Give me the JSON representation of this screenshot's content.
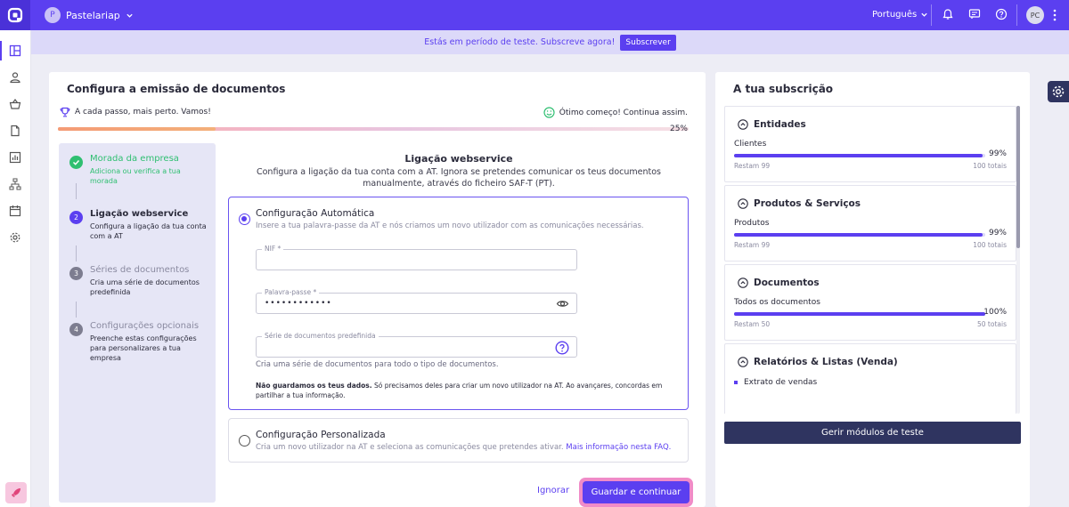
{
  "topbar": {
    "company_initial": "P",
    "company_name": "Pastelariap",
    "language": "Português",
    "user_initials": "PC"
  },
  "banner": {
    "text": "Estás em período de teste. Subscreve agora!",
    "button": "Subscrever"
  },
  "setup": {
    "title": "Configura a emissão de documentos",
    "progress_left": "A cada passo, mais perto. Vamos!",
    "progress_right": "Ótimo começo! Continua assim.",
    "progress_percent_label": "25%",
    "progress_value": 0.25,
    "steps": [
      {
        "number": "1",
        "title": "Morada da empresa",
        "desc": "Adiciona ou verifica a tua morada",
        "state": "done"
      },
      {
        "number": "2",
        "title": "Ligação webservice",
        "desc": "Configura a ligação da tua conta com a AT",
        "state": "active"
      },
      {
        "number": "3",
        "title": "Séries de documentos",
        "desc": "Cria uma série de documentos predefinida",
        "state": "pending"
      },
      {
        "number": "4",
        "title": "Configurações opcionais",
        "desc": "Preenche estas configurações para personalizares a tua empresa",
        "state": "pending"
      }
    ],
    "section_title": "Ligação webservice",
    "section_desc": "Configura a ligação da tua conta com a AT. Ignora se pretendes comunicar os teus documentos manualmente, através do ficheiro SAF-T (PT).",
    "auto": {
      "title": "Configuração Automática",
      "desc": "Insere a tua palavra-passe da AT e nós criamos um novo utilizador com as comunicações necessárias.",
      "nif_label": "NIF *",
      "nif_value": "",
      "password_label": "Palavra-passe *",
      "password_value": "••••••••••••",
      "series_label": "Série de documentos predefinida",
      "series_value": "",
      "series_help": "Cria uma série de documentos para todo o tipo de documentos.",
      "privacy_bold": "Não guardamos os teus dados.",
      "privacy_text": " Só precisamos deles para criar um novo utilizador na AT. Ao avançares, concordas em partilhar a tua informação."
    },
    "custom": {
      "title": "Configuração Personalizada",
      "desc": "Cria um novo utilizador na AT e seleciona as comunicações que pretendes ativar. ",
      "link": "Mais informação nesta FAQ."
    },
    "ignore_button": "Ignorar",
    "save_button": "Guardar e continuar"
  },
  "subscription": {
    "title": "A tua subscrição",
    "items": [
      {
        "title": "Entidades",
        "label": "Clientes",
        "percent_label": "99%",
        "percent": 99,
        "remaining": "Restam 99",
        "total": "100 totais"
      },
      {
        "title": "Produtos & Serviços",
        "label": "Produtos",
        "percent_label": "99%",
        "percent": 99,
        "remaining": "Restam 99",
        "total": "100 totais"
      },
      {
        "title": "Documentos",
        "label": "Todos os documentos",
        "percent_label": "100%",
        "percent": 100,
        "remaining": "Restam 50",
        "total": "50 totais"
      },
      {
        "title": "Relatórios & Listas (Venda)",
        "bullet": "Extrato de vendas"
      }
    ],
    "manage_button": "Gerir módulos de teste"
  },
  "colors": {
    "primary": "#5b3ff0",
    "success": "#2fbf71",
    "navy": "#2f3460"
  }
}
